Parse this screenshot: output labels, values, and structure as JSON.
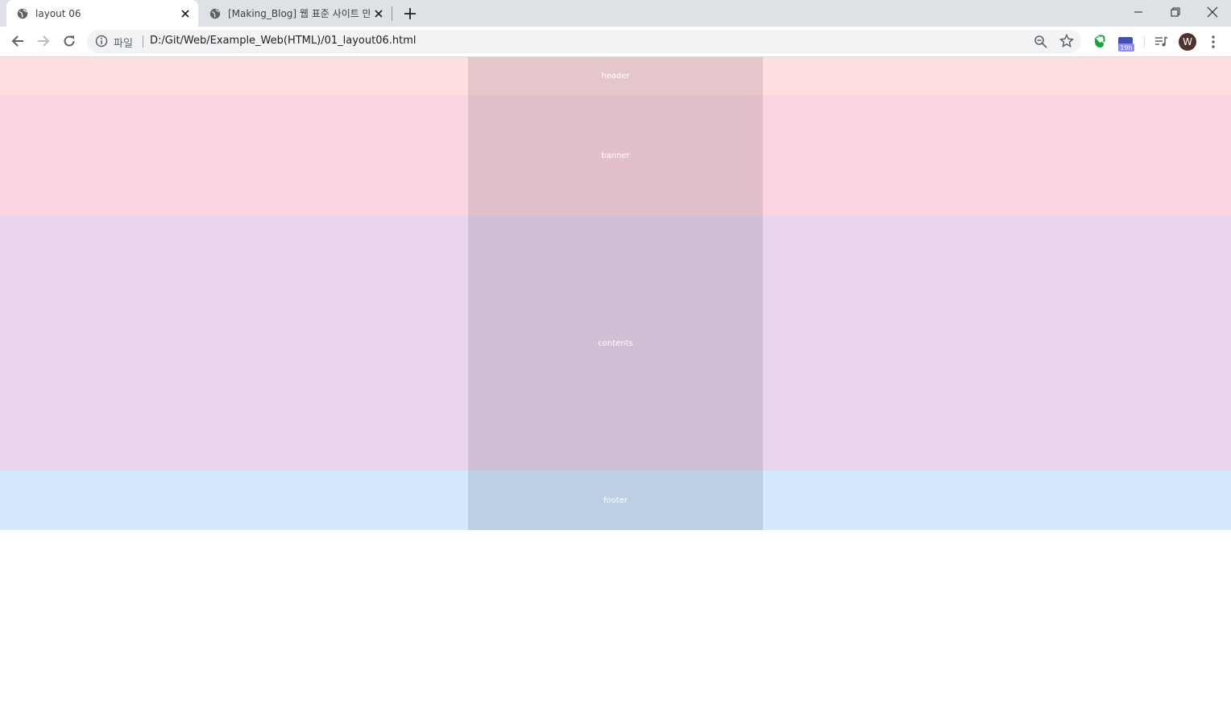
{
  "browser": {
    "tabs": [
      {
        "title": "layout 06",
        "active": true
      },
      {
        "title": "[Making_Blog] 웹 표준 사이트 만",
        "active": false
      }
    ],
    "address": {
      "scheme_label": "파일",
      "url": "D:/Git/Web/Example_Web(HTML)/01_layout06.html"
    },
    "extension_badge": "19h",
    "profile_initial": "W"
  },
  "page": {
    "sections": [
      {
        "id": "header",
        "label": "header"
      },
      {
        "id": "banner",
        "label": "banner"
      },
      {
        "id": "contents",
        "label": "contents"
      },
      {
        "id": "footer",
        "label": "footer"
      }
    ]
  },
  "colors": {
    "header_band": "#ffdee2",
    "banner_band": "#fbd6e2",
    "contents_band": "#e8d5ec",
    "footer_band": "#d3e8fd",
    "tabstrip": "#dee1e6"
  }
}
